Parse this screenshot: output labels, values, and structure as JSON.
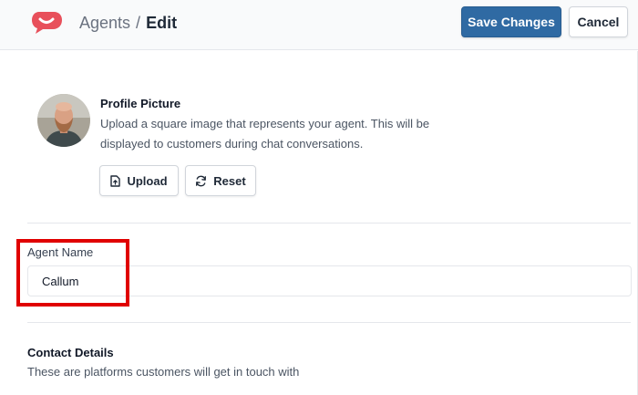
{
  "header": {
    "breadcrumb_parent": "Agents",
    "breadcrumb_separator": "/",
    "breadcrumb_current": "Edit",
    "save_label": "Save Changes",
    "cancel_label": "Cancel",
    "logo_icon": "chat-bubble-smile-logo",
    "brand_color": "#e8505b",
    "primary_color": "#2f6aa3"
  },
  "profile": {
    "title": "Profile Picture",
    "description": "Upload a square image that represents your agent. This will be displayed to customers during chat conversations.",
    "upload_label": "Upload",
    "upload_icon": "file-upload-icon",
    "reset_label": "Reset",
    "reset_icon": "refresh-icon"
  },
  "agent_name": {
    "label": "Agent Name",
    "value": "Callum"
  },
  "contact": {
    "title": "Contact Details",
    "description": "These are platforms customers will get in touch with"
  },
  "highlight_color": "#e00000"
}
